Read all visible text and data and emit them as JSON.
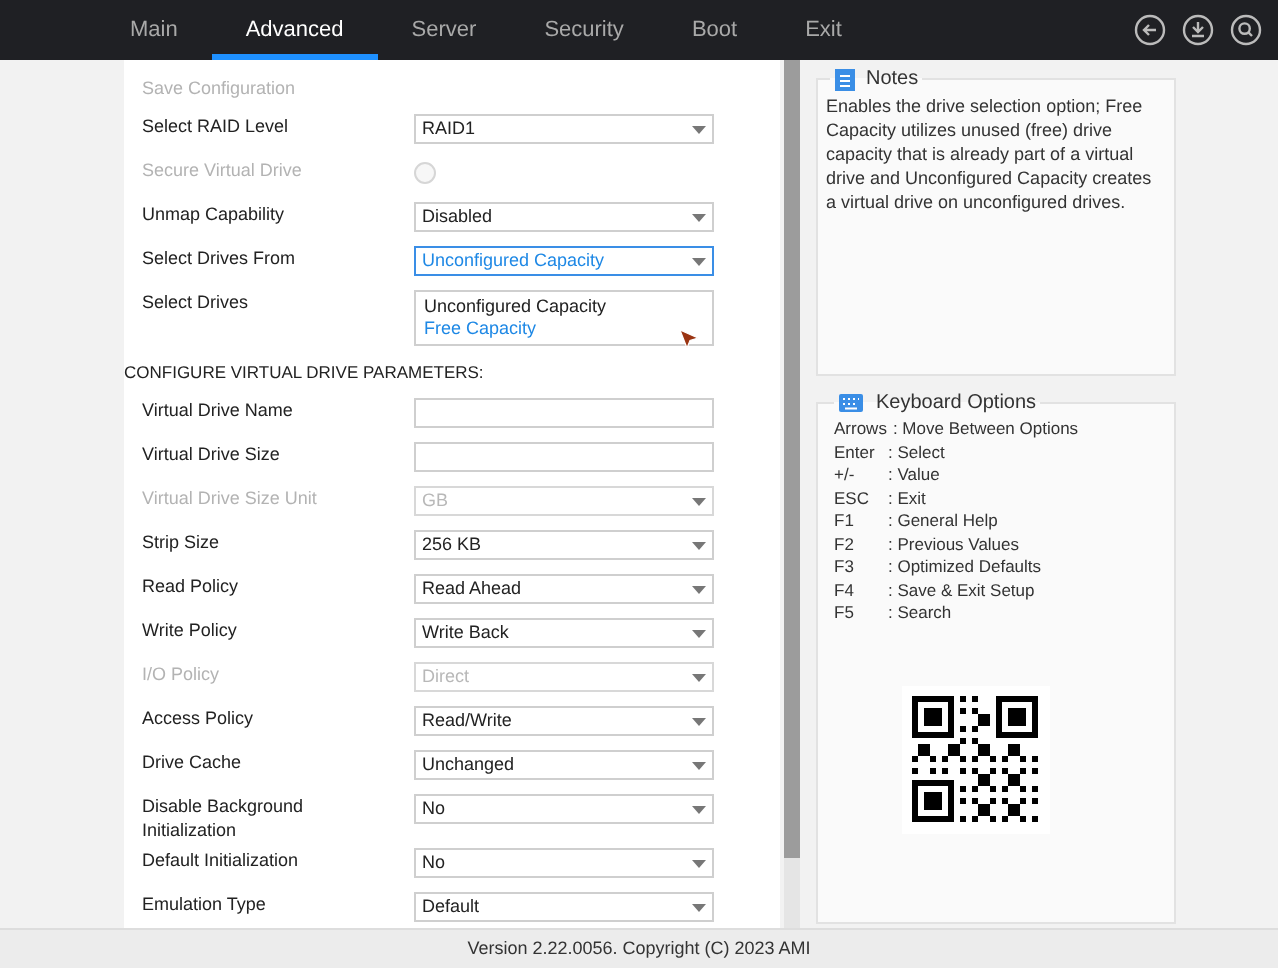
{
  "tabs": [
    {
      "label": "Main",
      "selected": false
    },
    {
      "label": "Advanced",
      "selected": true
    },
    {
      "label": "Server",
      "selected": false
    },
    {
      "label": "Security",
      "selected": false
    },
    {
      "label": "Boot",
      "selected": false
    },
    {
      "label": "Exit",
      "selected": false
    }
  ],
  "rows": [
    {
      "kind": "text",
      "label": "Save Configuration",
      "disabled": true
    },
    {
      "kind": "select",
      "label": "Select RAID Level",
      "value": "RAID1",
      "disabled": false,
      "focused": false
    },
    {
      "kind": "radio",
      "label": "Secure Virtual Drive",
      "disabled": true,
      "checked": false
    },
    {
      "kind": "select",
      "label": "Unmap Capability",
      "value": "Disabled",
      "disabled": false,
      "focused": false
    },
    {
      "kind": "select",
      "label": "Select Drives From",
      "value": "Unconfigured Capacity",
      "disabled": false,
      "focused": true
    },
    {
      "kind": "listbox",
      "label": "Select Drives",
      "options": [
        {
          "label": "Unconfigured Capacity",
          "selected": false
        },
        {
          "label": "Free Capacity",
          "selected": true
        }
      ]
    },
    {
      "kind": "heading",
      "label": "CONFIGURE VIRTUAL DRIVE PARAMETERS:"
    },
    {
      "kind": "input",
      "label": "Virtual Drive Name",
      "disabled": false
    },
    {
      "kind": "input",
      "label": "Virtual Drive Size",
      "disabled": false
    },
    {
      "kind": "select",
      "label": "Virtual Drive Size Unit",
      "value": "GB",
      "disabled": true,
      "focused": false
    },
    {
      "kind": "select",
      "label": "Strip Size",
      "value": "256 KB",
      "disabled": false,
      "focused": false
    },
    {
      "kind": "select",
      "label": "Read Policy",
      "value": "Read Ahead",
      "disabled": false,
      "focused": false
    },
    {
      "kind": "select",
      "label": "Write Policy",
      "value": "Write Back",
      "disabled": false,
      "focused": false
    },
    {
      "kind": "select",
      "label": "I/O Policy",
      "value": "Direct",
      "disabled": true,
      "focused": false
    },
    {
      "kind": "select",
      "label": "Access Policy",
      "value": "Read/Write",
      "disabled": false,
      "focused": false
    },
    {
      "kind": "select",
      "label": "Drive Cache",
      "value": "Unchanged",
      "disabled": false,
      "focused": false
    },
    {
      "kind": "select",
      "label": "Disable Background Initialization",
      "value": "No",
      "disabled": false,
      "focused": false
    },
    {
      "kind": "select",
      "label": "Default Initialization",
      "value": "No",
      "disabled": false,
      "focused": false
    },
    {
      "kind": "select",
      "label": "Emulation Type",
      "value": "Default",
      "disabled": false,
      "focused": false
    }
  ],
  "notes": {
    "title": "Notes",
    "text": "Enables the drive selection option; Free Capacity utilizes unused (free) drive capacity that is already part of a virtual drive and Unconfigured Capacity creates a virtual drive on unconfigured drives."
  },
  "keyboard": {
    "title": "Keyboard Options",
    "keys": [
      {
        "key": "Arrows",
        "action": ": Move Between Options"
      },
      {
        "key": "Enter",
        "action": ": Select"
      },
      {
        "key": "+/-",
        "action": ": Value"
      },
      {
        "key": "ESC",
        "action": ": Exit"
      },
      {
        "key": "F1",
        "action": ": General Help"
      },
      {
        "key": "F2",
        "action": ": Previous Values"
      },
      {
        "key": "F3",
        "action": ": Optimized Defaults"
      },
      {
        "key": "F4",
        "action": ": Save & Exit Setup"
      },
      {
        "key": "F5",
        "action": ": Search"
      }
    ]
  },
  "footer": "Version 2.22.0056. Copyright (C) 2023 AMI"
}
